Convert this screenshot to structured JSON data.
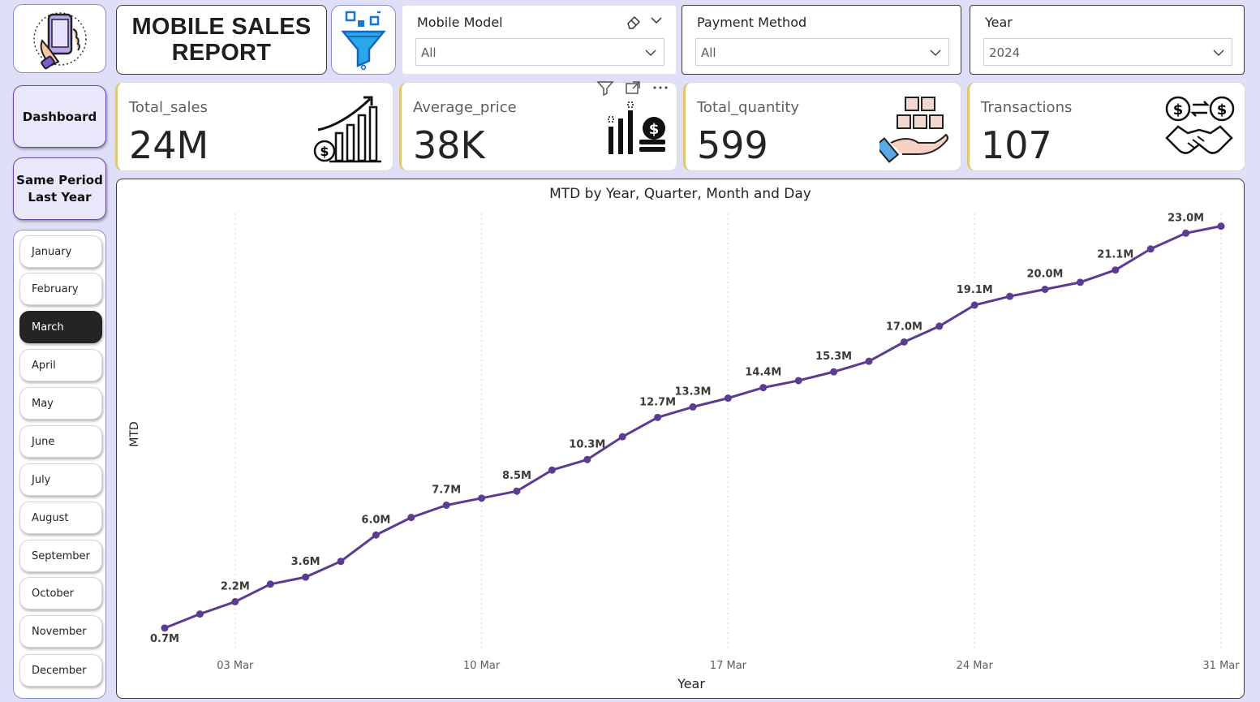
{
  "header": {
    "title_line1": "MOBILE SALES",
    "title_line2": "REPORT"
  },
  "slicers": {
    "mobile_model": {
      "label": "Mobile Model",
      "value": "All"
    },
    "payment_method": {
      "label": "Payment Method",
      "value": "All"
    },
    "year": {
      "label": "Year",
      "value": "2024"
    }
  },
  "nav": {
    "dashboard": "Dashboard",
    "same_period_line1": "Same Period",
    "same_period_line2": "Last Year"
  },
  "months": {
    "items": [
      "January",
      "February",
      "March",
      "April",
      "May",
      "June",
      "July",
      "August",
      "September",
      "October",
      "November",
      "December"
    ],
    "selected": "March"
  },
  "kpis": {
    "total_sales": {
      "label": "Total_sales",
      "value": "24M"
    },
    "average_price": {
      "label": "Average_price",
      "value": "38K"
    },
    "total_quantity": {
      "label": "Total_quantity",
      "value": "599"
    },
    "transactions": {
      "label": "Transactions",
      "value": "107"
    }
  },
  "colors": {
    "line": "#5b3c91",
    "selected_month": "#252423",
    "kpi_accent": "#e0c870"
  },
  "chart_data": {
    "type": "line",
    "title": "MTD by Year, Quarter, Month and Day",
    "xlabel": "Year",
    "ylabel": "MTD",
    "x_ticks": [
      "03 Mar",
      "10 Mar",
      "17 Mar",
      "24 Mar",
      "31 Mar"
    ],
    "x": [
      "01 Mar",
      "02 Mar",
      "03 Mar",
      "04 Mar",
      "05 Mar",
      "06 Mar",
      "07 Mar",
      "08 Mar",
      "09 Mar",
      "10 Mar",
      "11 Mar",
      "12 Mar",
      "13 Mar",
      "14 Mar",
      "15 Mar",
      "16 Mar",
      "17 Mar",
      "18 Mar",
      "19 Mar",
      "20 Mar",
      "21 Mar",
      "22 Mar",
      "23 Mar",
      "24 Mar",
      "25 Mar",
      "26 Mar",
      "27 Mar",
      "28 Mar",
      "29 Mar",
      "30 Mar",
      "31 Mar"
    ],
    "series": [
      {
        "values": [
          0.7,
          1.5,
          2.2,
          3.2,
          3.6,
          4.5,
          6.0,
          7.0,
          7.7,
          8.1,
          8.5,
          9.7,
          10.3,
          11.6,
          12.7,
          13.3,
          13.8,
          14.4,
          14.8,
          15.3,
          15.9,
          17.0,
          17.9,
          19.1,
          19.6,
          20.0,
          20.4,
          21.1,
          22.3,
          23.2,
          23.6
        ]
      }
    ],
    "data_labels": [
      {
        "x": "01 Mar",
        "text": "0.7M",
        "pos": "below"
      },
      {
        "x": "03 Mar",
        "text": "2.2M",
        "pos": "above"
      },
      {
        "x": "05 Mar",
        "text": "3.6M",
        "pos": "above"
      },
      {
        "x": "07 Mar",
        "text": "6.0M",
        "pos": "above"
      },
      {
        "x": "09 Mar",
        "text": "7.7M",
        "pos": "above"
      },
      {
        "x": "11 Mar",
        "text": "8.5M",
        "pos": "above"
      },
      {
        "x": "13 Mar",
        "text": "10.3M",
        "pos": "above"
      },
      {
        "x": "15 Mar",
        "text": "12.7M",
        "pos": "above"
      },
      {
        "x": "16 Mar",
        "text": "13.3M",
        "pos": "above"
      },
      {
        "x": "18 Mar",
        "text": "14.4M",
        "pos": "above"
      },
      {
        "x": "20 Mar",
        "text": "15.3M",
        "pos": "above"
      },
      {
        "x": "22 Mar",
        "text": "17.0M",
        "pos": "above"
      },
      {
        "x": "24 Mar",
        "text": "19.1M",
        "pos": "above"
      },
      {
        "x": "26 Mar",
        "text": "20.0M",
        "pos": "above"
      },
      {
        "x": "28 Mar",
        "text": "21.1M",
        "pos": "above"
      },
      {
        "x": "30 Mar",
        "text": "23.0M",
        "pos": "above"
      }
    ],
    "ylim": [
      0,
      24
    ],
    "grid": "vertical-dotted"
  }
}
